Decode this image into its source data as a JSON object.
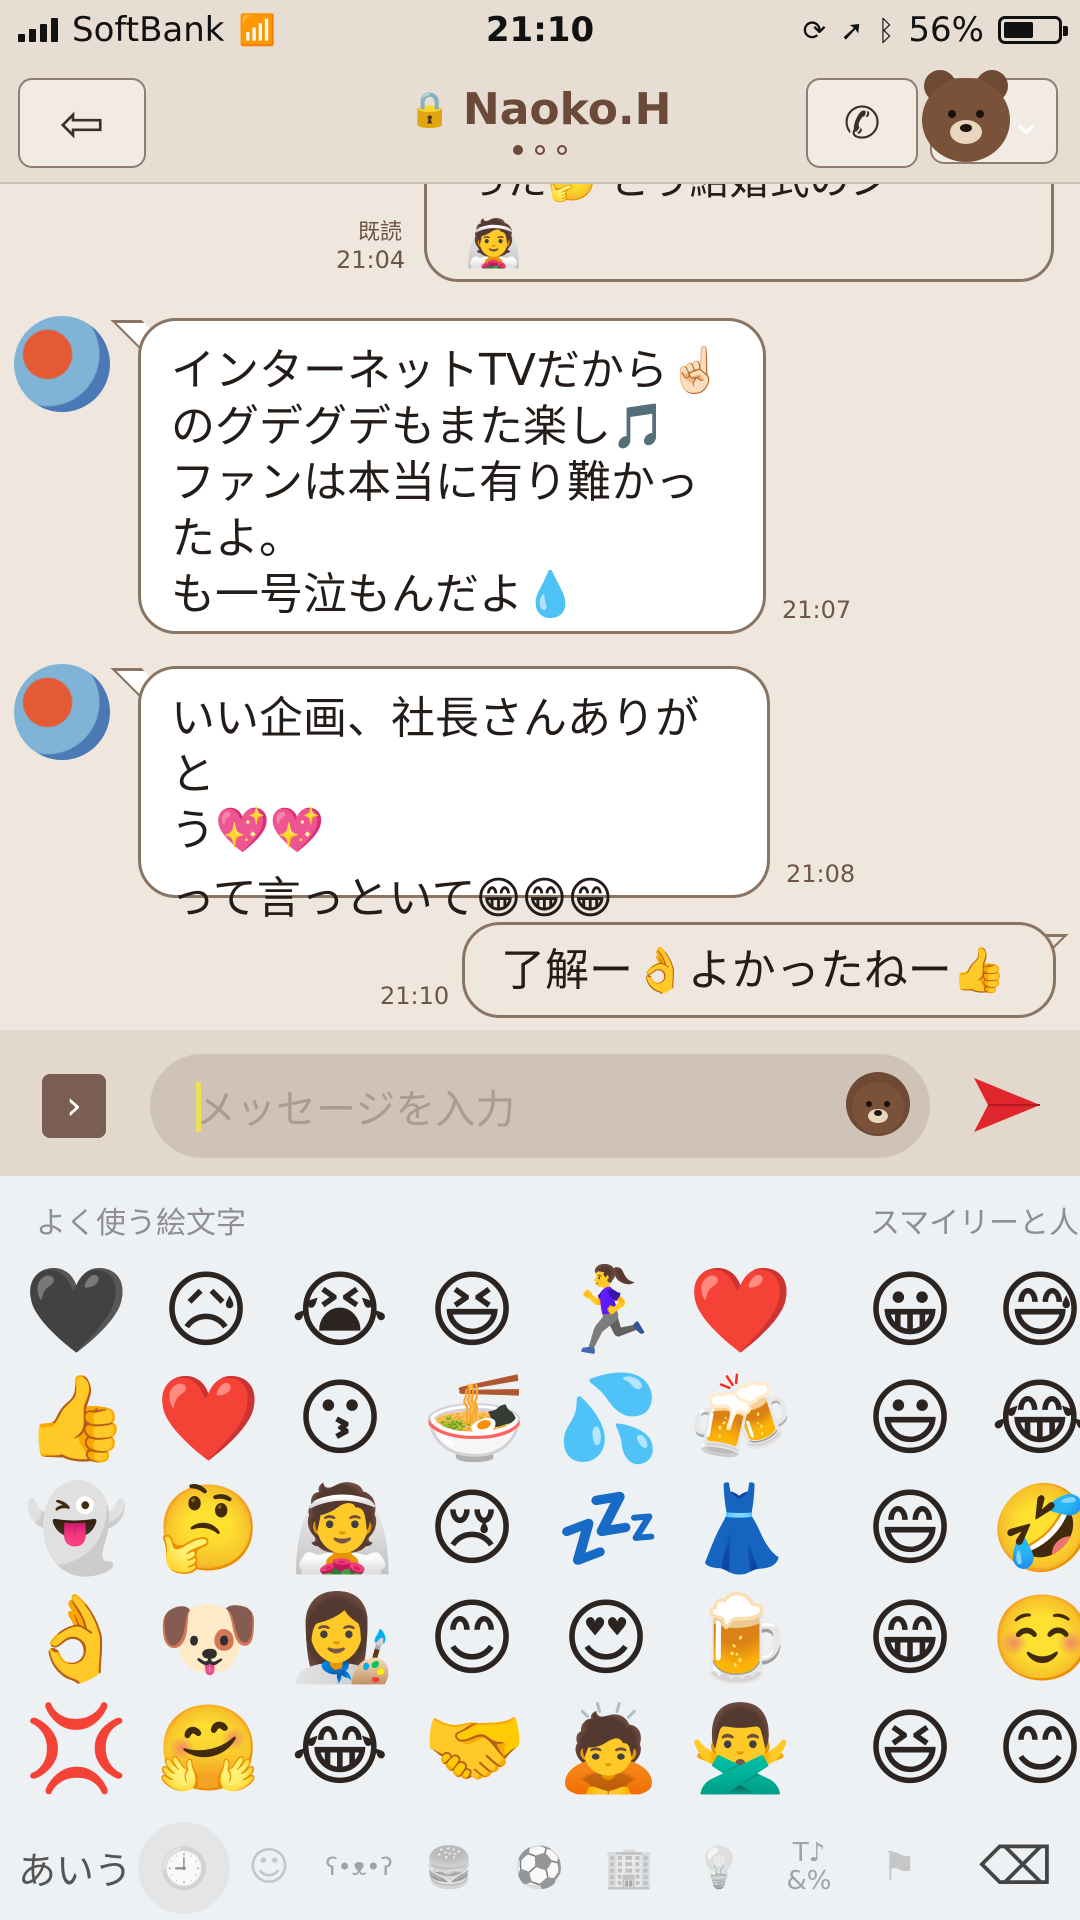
{
  "statusbar": {
    "carrier": "SoftBank",
    "time": "21:10",
    "battery_percent": "56%",
    "battery_level": 0.56,
    "icons": [
      "signal-bars-icon",
      "wifi-icon",
      "rotation-lock-icon",
      "location-arrow-icon",
      "bluetooth-icon",
      "battery-icon"
    ]
  },
  "header": {
    "title": "Naoko.H",
    "back_icon": "back-arrow-icon",
    "call_icon": "phone-icon",
    "menu_icon": "chevron-down-icon",
    "page_index": 0,
    "page_count": 3
  },
  "messages": [
    {
      "id": "m0",
      "from": "me",
      "partial_text": "った🤔 とう結婚式のシ",
      "emoji": "👰",
      "read": "既読",
      "time": "21:04"
    },
    {
      "id": "m1",
      "from": "other",
      "lines": [
        "インターネットTVだから☝🏻",
        "のグデグデもまた楽し🎵",
        "ファンは本当に有り難かっ",
        "たよ。",
        "も一号泣もんだよ💧"
      ],
      "time": "21:07"
    },
    {
      "id": "m2",
      "from": "other",
      "lines": [
        "いい企画、社長さんありがと",
        "う💖💖",
        "って言っといて😁😁😁"
      ],
      "time": "21:08"
    },
    {
      "id": "m3",
      "from": "me",
      "text": "了解ー👌よかったねー👍",
      "time": "21:10"
    }
  ],
  "composer": {
    "placeholder": "メッセージを入力",
    "expand_icon": "chevron-right-icon",
    "sticker_icon": "bear-sticker-icon",
    "send_icon": "send-arrow-icon"
  },
  "keyboard": {
    "section_frequent": "よく使う絵文字",
    "section_smileys": "スマイリーと人",
    "frequent_emoji": [
      [
        "🖤",
        "😥",
        "😭",
        "😆",
        "🏃‍♀️",
        "❤️"
      ],
      [
        "👍",
        "❤️",
        "😗",
        "🍜",
        "💦",
        "🍻"
      ],
      [
        "👻",
        "🤔",
        "👰",
        "😢",
        "💤",
        "👗"
      ],
      [
        "👌",
        "🐶",
        "👩‍🎨",
        "😊",
        "😍",
        "🍺"
      ],
      [
        "💢",
        "🤗",
        "😂",
        "🤝",
        "🙇",
        "🙅‍♂️"
      ]
    ],
    "smiley_emoji": [
      [
        "😀",
        "😅"
      ],
      [
        "😃",
        "😂"
      ],
      [
        "😄",
        "🤣"
      ],
      [
        "😁",
        "☺️"
      ],
      [
        "😆",
        "😊"
      ]
    ],
    "bottom_bar": {
      "ime_label": "あいう",
      "icons": [
        "clock-icon",
        "smiley-icon",
        "bear-icon",
        "food-icon",
        "ball-icon",
        "building-icon",
        "bulb-icon",
        "symbols-icon",
        "flag-icon",
        "backspace-icon"
      ],
      "symbols_label": "T♪\n&%",
      "active_index": 0
    }
  }
}
